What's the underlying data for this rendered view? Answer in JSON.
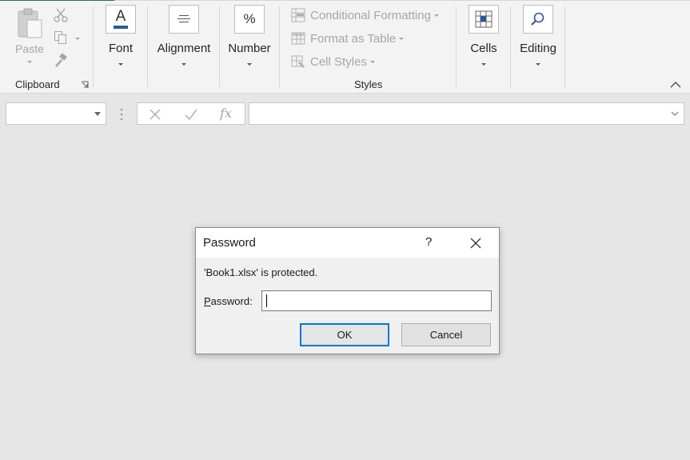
{
  "ribbon": {
    "clipboard": {
      "paste_label": "Paste",
      "group_label": "Clipboard"
    },
    "font": {
      "label": "Font"
    },
    "alignment": {
      "label": "Alignment"
    },
    "number": {
      "label": "Number",
      "icon_glyph": "%"
    },
    "styles": {
      "conditional_formatting": "Conditional Formatting",
      "format_as_table": "Format as Table",
      "cell_styles": "Cell Styles",
      "group_label": "Styles"
    },
    "cells": {
      "label": "Cells"
    },
    "editing": {
      "label": "Editing"
    }
  },
  "formula_bar": {
    "name_box_value": "",
    "formula_value": "",
    "fx_label": "fx"
  },
  "dialog": {
    "title": "Password",
    "help_glyph": "?",
    "message": "'Book1.xlsx' is protected.",
    "password_label_mnemonic": "P",
    "password_label_rest": "assword:",
    "password_value": "",
    "ok_label": "OK",
    "cancel_label": "Cancel"
  },
  "colors": {
    "accent": "#217346",
    "ok_border": "#0078d7"
  }
}
